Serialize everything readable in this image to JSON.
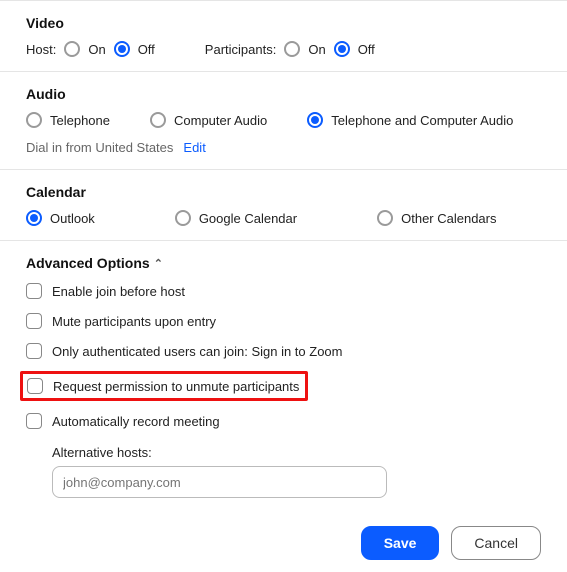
{
  "video": {
    "title": "Video",
    "host_label": "Host:",
    "participants_label": "Participants:",
    "on_label": "On",
    "off_label": "Off"
  },
  "audio": {
    "title": "Audio",
    "telephone": "Telephone",
    "computer": "Computer Audio",
    "both": "Telephone and Computer Audio",
    "dial_text": "Dial in from United States",
    "edit": "Edit"
  },
  "calendar": {
    "title": "Calendar",
    "outlook": "Outlook",
    "google": "Google Calendar",
    "other": "Other Calendars"
  },
  "advanced": {
    "title": "Advanced Options",
    "enable_join": "Enable join before host",
    "mute_entry": "Mute participants upon entry",
    "auth_only": "Only authenticated users can join: Sign in to Zoom",
    "request_unmute": "Request permission to unmute participants",
    "auto_record": "Automatically record meeting",
    "alt_hosts_label": "Alternative hosts:",
    "alt_hosts_placeholder": "john@company.com"
  },
  "footer": {
    "save": "Save",
    "cancel": "Cancel"
  }
}
